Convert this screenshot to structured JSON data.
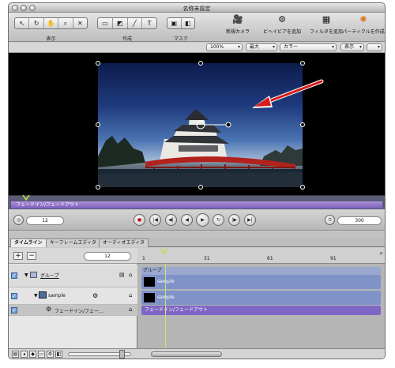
{
  "window": {
    "title": "名称未設定"
  },
  "toolbar": {
    "groups": [
      {
        "label": "表示",
        "tools": [
          "↖",
          "↻",
          "✋",
          "⌕",
          "✕"
        ]
      },
      {
        "label": "作成",
        "tools": [
          "▭",
          "◩",
          "╱",
          "T"
        ]
      },
      {
        "label": "マスク",
        "tools": [
          "▣",
          "◧"
        ]
      }
    ],
    "buttons": [
      {
        "label": "新規カメラ",
        "icon": "camera-icon"
      },
      {
        "label": "ビヘイビアを追加",
        "icon": "gear-icon"
      },
      {
        "label": "フィルタを追加",
        "icon": "filter-icon"
      },
      {
        "label": "パーティクルを作成",
        "icon": "particle-icon"
      }
    ]
  },
  "options": {
    "zoom": "100%",
    "resolution": "最大",
    "channel": "カラー",
    "view": "表示"
  },
  "canvas": {
    "range_label": "フェードイン/フェードアウト"
  },
  "transport": {
    "start_frame": "12",
    "end_frame": "300"
  },
  "tabs": [
    "タイムライン",
    "キーフレームエディタ",
    "オーディオエディタ"
  ],
  "timeline": {
    "current_frame": "12",
    "ruler_ticks": [
      "1",
      "31",
      "61",
      "91"
    ],
    "rows": [
      {
        "label": "グループ",
        "bar_label": "グループ"
      },
      {
        "label": "sample",
        "bar_label": "sample"
      },
      {
        "label": "sample",
        "bar_label": "sample"
      },
      {
        "label": "フェードイン/フェー...",
        "bar_label": "フェードイン/フェードアウト"
      }
    ]
  },
  "colors": {
    "accent_purple": "#8066c4",
    "track_blue": "#7f93c8",
    "select_check": "#7aa3d6"
  }
}
